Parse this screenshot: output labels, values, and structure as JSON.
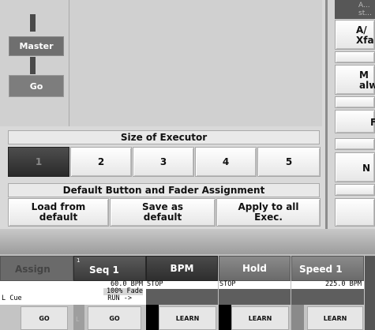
{
  "left": {
    "master_label": "Master",
    "go_label": "Go"
  },
  "size_of_executor": {
    "title": "Size of Executor",
    "sizes": [
      "1",
      "2",
      "3",
      "4",
      "5"
    ]
  },
  "default_assign": {
    "title": "Default Button and Fader Assignment",
    "load_label": "Load from default",
    "save_label": "Save as default",
    "apply_label": "Apply to all Exec."
  },
  "right_column": {
    "top_tab": "A... st...",
    "item1": "A/ Xfa",
    "item2": "M alw.",
    "item3": "F",
    "item4": "N"
  },
  "executors": [
    {
      "head": "Assign",
      "line1": "",
      "line2": "",
      "line3": "L Cue",
      "button": "GO"
    },
    {
      "index": "1",
      "head": "Seq 1",
      "line1": "60.0 BPM",
      "line2": "100% Fade",
      "line3": "RUN ->",
      "side_label": "L",
      "button": "GO"
    },
    {
      "head": "BPM",
      "line1": "STOP",
      "button": "LEARN"
    },
    {
      "head": "Hold",
      "line1": "STOP",
      "button": "LEARN"
    },
    {
      "head": "Speed 1",
      "line1": "225.0 BPM",
      "button": "LEARN"
    }
  ]
}
